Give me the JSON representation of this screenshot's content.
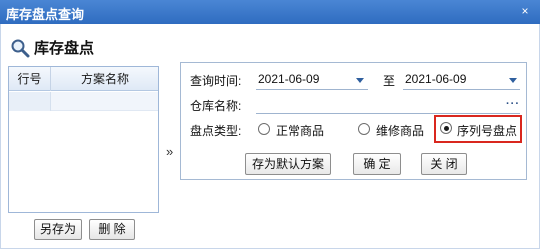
{
  "window": {
    "title": "库存盘点查询",
    "close_glyph": "×"
  },
  "heading": {
    "title": "库存盘点",
    "icon": "search-icon"
  },
  "grid": {
    "columns": [
      "行号",
      "方案名称"
    ],
    "rows": [
      [
        "",
        ""
      ]
    ]
  },
  "grid_buttons": {
    "save_as": "另存为",
    "delete": "删 除"
  },
  "expander": {
    "glyph": "»"
  },
  "form": {
    "query_time_label": "查询时间:",
    "date_from": "2021-06-09",
    "to_label": "至",
    "date_to": "2021-06-09",
    "warehouse_label": "仓库名称:",
    "warehouse_value": "",
    "browse_glyph": "···",
    "count_type_label": "盘点类型:",
    "count_types": [
      {
        "label": "正常商品",
        "selected": false
      },
      {
        "label": "维修商品",
        "selected": false
      },
      {
        "label": "序列号盘点",
        "selected": true
      }
    ]
  },
  "actions": {
    "save_default": "存为默认方案",
    "confirm": "确 定",
    "close": "关 闭"
  },
  "colors": {
    "title_bar": "#3a78cc",
    "highlight": "#d9271e",
    "dropdown_arrow": "#2f5f9e"
  }
}
